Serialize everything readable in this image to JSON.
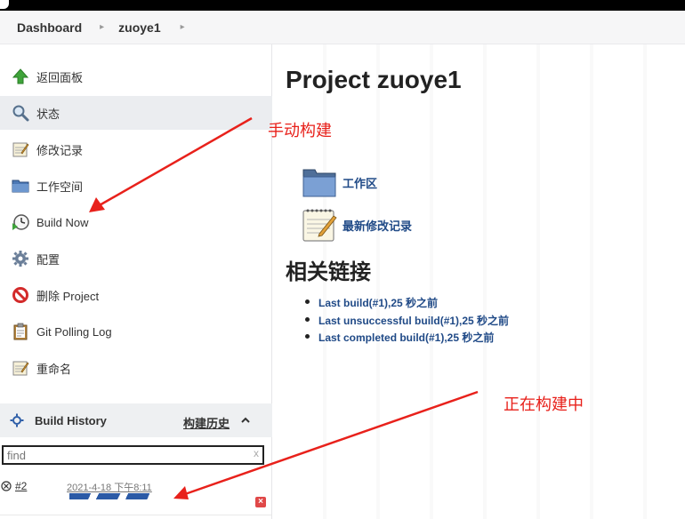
{
  "breadcrumb": {
    "dashboard": "Dashboard",
    "project": "zuoye1"
  },
  "sidebar": {
    "items": [
      {
        "label": "返回面板",
        "icon": "up-arrow-icon"
      },
      {
        "label": "状态",
        "icon": "magnifier-icon"
      },
      {
        "label": "修改记录",
        "icon": "notepad-icon"
      },
      {
        "label": "工作空间",
        "icon": "folder-icon"
      },
      {
        "label": "Build Now",
        "icon": "clock-play-icon"
      },
      {
        "label": "配置",
        "icon": "gear-icon"
      },
      {
        "label": "删除 Project",
        "icon": "no-entry-icon"
      },
      {
        "label": "Git Polling Log",
        "icon": "clipboard-icon"
      },
      {
        "label": "重命名",
        "icon": "notepad-icon"
      }
    ]
  },
  "build_history": {
    "title": "Build History",
    "trend_link": "构建历史",
    "filter_placeholder": "find",
    "filter_clear": "x",
    "builds": [
      {
        "number": "#2",
        "time": "2021-4-18 下午8:11"
      }
    ]
  },
  "main": {
    "title": "Project zuoye1",
    "links": [
      {
        "label": "工作区",
        "icon": "folder-icon"
      },
      {
        "label": "最新修改记录",
        "icon": "notepad-icon"
      }
    ],
    "permalinks_title": "相关链接",
    "permalinks": [
      "Last build(#1),25 秒之前",
      "Last unsuccessful build(#1),25 秒之前",
      "Last completed build(#1),25 秒之前"
    ]
  },
  "annotations": {
    "manual_build": "手动构建",
    "building": "正在构建中"
  },
  "colors": {
    "accent": "#204a87",
    "annotation": "#e8211b",
    "progress": "#2b5aa6"
  }
}
